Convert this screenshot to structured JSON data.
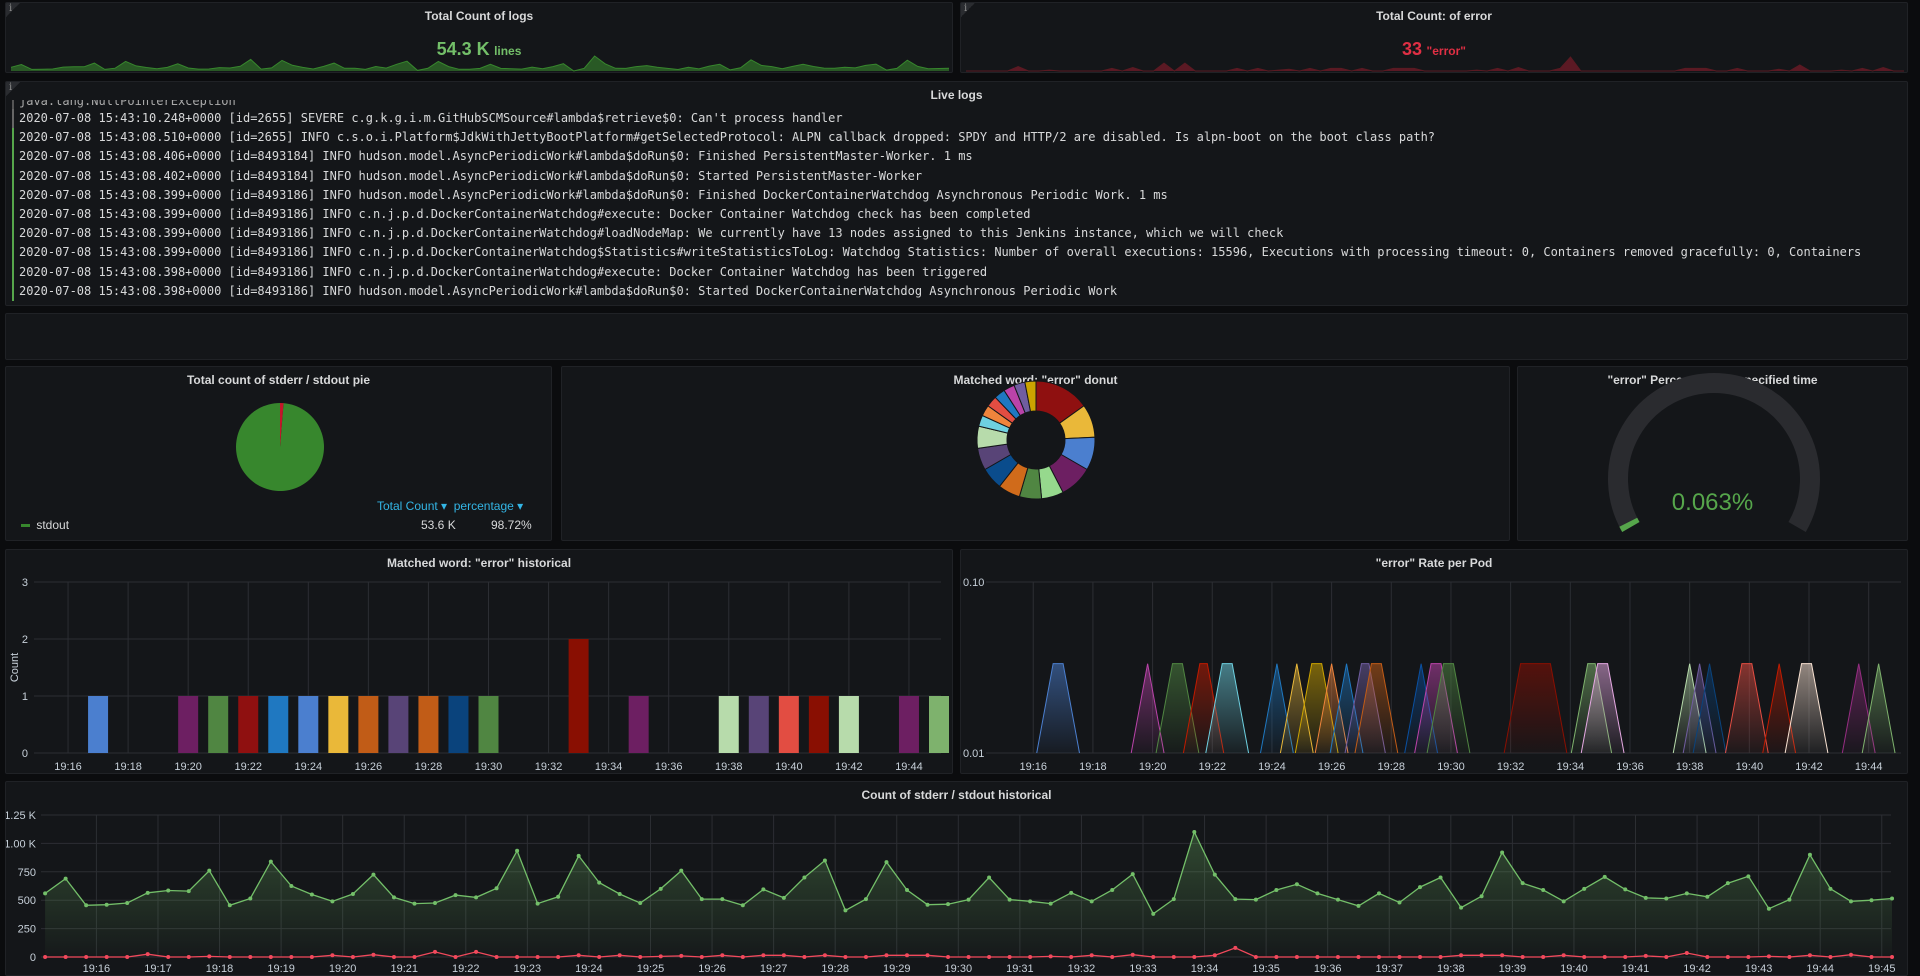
{
  "colors": {
    "green": "#56a64b",
    "green_dark": "#37872d",
    "red": "#e02f44",
    "panel_bg": "#141619",
    "grid": "#2c2e33"
  },
  "panels": {
    "total_logs": {
      "title": "Total Count of logs",
      "value": "54.3 K",
      "unit": "lines",
      "color": "#73bf69"
    },
    "total_errors": {
      "title": "Total Count: of error",
      "value": "33",
      "unit": "\"error\"",
      "color": "#e02f44"
    },
    "live_logs": {
      "title": "Live logs",
      "lines": [
        "java.lang.NullPointerException",
        "2020-07-08 15:43:10.248+0000 [id=2655] SEVERE c.g.k.g.i.m.GitHubSCMSource#lambda$retrieve$0: Can't process handler",
        "2020-07-08 15:43:08.510+0000 [id=2655] INFO c.s.o.i.Platform$JdkWithJettyBootPlatform#getSelectedProtocol: ALPN callback dropped: SPDY and HTTP/2 are disabled. Is alpn-boot on the boot class path?",
        "2020-07-08 15:43:08.406+0000 [id=8493184] INFO hudson.model.AsyncPeriodicWork#lambda$doRun$0: Finished PersistentMaster-Worker. 1 ms",
        "2020-07-08 15:43:08.402+0000 [id=8493184] INFO hudson.model.AsyncPeriodicWork#lambda$doRun$0: Started PersistentMaster-Worker",
        "2020-07-08 15:43:08.399+0000 [id=8493186] INFO hudson.model.AsyncPeriodicWork#lambda$doRun$0: Finished DockerContainerWatchdog Asynchronous Periodic Work. 1 ms",
        "2020-07-08 15:43:08.399+0000 [id=8493186] INFO c.n.j.p.d.DockerContainerWatchdog#execute: Docker Container Watchdog check has been completed",
        "2020-07-08 15:43:08.399+0000 [id=8493186] INFO c.n.j.p.d.DockerContainerWatchdog#loadNodeMap: We currently have 13 nodes assigned to this Jenkins instance, which we will check",
        "2020-07-08 15:43:08.399+0000 [id=8493186] INFO c.n.j.p.d.DockerContainerWatchdog$Statistics#writeStatisticsToLog: Watchdog Statistics: Number of overall executions: 15596, Executions with processing timeout: 0, Containers removed gracefully: 0, Containers",
        "2020-07-08 15:43:08.398+0000 [id=8493186] INFO c.n.j.p.d.DockerContainerWatchdog#execute: Docker Container Watchdog has been triggered",
        "2020-07-08 15:43:08.398+0000 [id=8493186] INFO hudson.model.AsyncPeriodicWork#lambda$doRun$0: Started DockerContainerWatchdog Asynchronous Periodic Work"
      ]
    },
    "pie": {
      "title": "Total count of stderr / stdout pie",
      "col_total": "Total Count",
      "col_pct": "percentage",
      "rows": [
        {
          "name": "stdout",
          "total": "53.6 K",
          "pct": "98.72%",
          "value": 98.72,
          "color": "#37872d"
        }
      ],
      "other_slice": {
        "value": 1.28,
        "color": "#c4162a"
      }
    },
    "donut": {
      "title": "Matched word: \"error\" donut",
      "slices": [
        {
          "value": 5,
          "color": "#8f1010"
        },
        {
          "value": 3,
          "color": "#eab839"
        },
        {
          "value": 3,
          "color": "#4b7fcf"
        },
        {
          "value": 3,
          "color": "#6d1f62"
        },
        {
          "value": 2,
          "color": "#96d98d"
        },
        {
          "value": 2,
          "color": "#508642"
        },
        {
          "value": 2,
          "color": "#d06b1b"
        },
        {
          "value": 2,
          "color": "#0a4c8c"
        },
        {
          "value": 2,
          "color": "#584477"
        },
        {
          "value": 2,
          "color": "#b7dbab"
        },
        {
          "value": 1,
          "color": "#6ed0e0"
        },
        {
          "value": 1,
          "color": "#ef843c"
        },
        {
          "value": 1,
          "color": "#e24d42"
        },
        {
          "value": 1,
          "color": "#1f78c1"
        },
        {
          "value": 1,
          "color": "#ba43a9"
        },
        {
          "value": 1,
          "color": "#705da0"
        },
        {
          "value": 1,
          "color": "#cca300"
        }
      ]
    },
    "gauge": {
      "title": "\"error\" Percentage for specified time",
      "value_text": "0.063%",
      "value": 0.063,
      "min": 0,
      "max": 100,
      "color": "#56a64b"
    }
  },
  "chart_data": [
    {
      "type": "bar",
      "title": "Matched word: \"error\" historical",
      "ylabel": "Count",
      "ylim": [
        0,
        3
      ],
      "yticks": [
        "0",
        "1",
        "2",
        "3"
      ],
      "xticks": [
        "19:16",
        "19:18",
        "19:20",
        "19:22",
        "19:24",
        "19:26",
        "19:28",
        "19:30",
        "19:32",
        "19:34",
        "19:36",
        "19:38",
        "19:40",
        "19:42",
        "19:44"
      ],
      "bars": [
        {
          "x": "19:17",
          "value": 1,
          "color": "#4b7fcf"
        },
        {
          "x": "19:20",
          "value": 1,
          "color": "#6d1f62"
        },
        {
          "x": "19:21",
          "value": 1,
          "color": "#508642"
        },
        {
          "x": "19:22",
          "value": 1,
          "color": "#8f1010"
        },
        {
          "x": "19:23",
          "value": 1,
          "color": "#1f78c1"
        },
        {
          "x": "19:24",
          "value": 1,
          "color": "#4b7fcf"
        },
        {
          "x": "19:25",
          "value": 1,
          "color": "#eab839"
        },
        {
          "x": "19:26",
          "value": 1,
          "color": "#c15c17"
        },
        {
          "x": "19:27",
          "value": 1,
          "color": "#584477"
        },
        {
          "x": "19:28",
          "value": 1,
          "color": "#c15c17"
        },
        {
          "x": "19:29",
          "value": 1,
          "color": "#0a437c"
        },
        {
          "x": "19:30",
          "value": 1,
          "color": "#508642"
        },
        {
          "x": "19:33",
          "value": 2,
          "color": "#890f02"
        },
        {
          "x": "19:35",
          "value": 1,
          "color": "#6d1f62"
        },
        {
          "x": "19:38",
          "value": 1,
          "color": "#b7dbab"
        },
        {
          "x": "19:39",
          "value": 1,
          "color": "#584477"
        },
        {
          "x": "19:40",
          "value": 1,
          "color": "#e24d42"
        },
        {
          "x": "19:41",
          "value": 1,
          "color": "#890f02"
        },
        {
          "x": "19:42",
          "value": 1,
          "color": "#b7dbab"
        },
        {
          "x": "19:44",
          "value": 1,
          "color": "#6d1f62"
        },
        {
          "x": "19:45",
          "value": 1,
          "color": "#7eb26d"
        }
      ]
    },
    {
      "type": "area",
      "title": "\"error\" Rate per Pod",
      "yscale": "log",
      "ylim": [
        0.01,
        0.1
      ],
      "yticks": [
        "0.01",
        "0.10"
      ],
      "xticks": [
        "19:16",
        "19:18",
        "19:20",
        "19:22",
        "19:24",
        "19:26",
        "19:28",
        "19:30",
        "19:32",
        "19:34",
        "19:36",
        "19:38",
        "19:40",
        "19:42",
        "19:44"
      ],
      "peak": 0.0333,
      "spikes": [
        {
          "from": "19:16:40",
          "to": "19:17:00",
          "color": "#4b7fcf"
        },
        {
          "from": "19:19:50",
          "to": "19:19:50",
          "color": "#ba43a9"
        },
        {
          "from": "19:20:40",
          "to": "19:21:00",
          "color": "#508642"
        },
        {
          "from": "19:21:35",
          "to": "19:21:50",
          "color": "#bf1b00"
        },
        {
          "from": "19:22:20",
          "to": "19:22:40",
          "color": "#6ed0e0"
        },
        {
          "from": "19:24:10",
          "to": "19:24:10",
          "color": "#1f78c1"
        },
        {
          "from": "19:24:50",
          "to": "19:24:50",
          "color": "#eab839"
        },
        {
          "from": "19:25:20",
          "to": "19:25:40",
          "color": "#cca300"
        },
        {
          "from": "19:26:00",
          "to": "19:26:00",
          "color": "#ef843c"
        },
        {
          "from": "19:26:30",
          "to": "19:26:30",
          "color": "#1f78c1"
        },
        {
          "from": "19:27:00",
          "to": "19:27:15",
          "color": "#705da0"
        },
        {
          "from": "19:27:20",
          "to": "19:27:40",
          "color": "#c15c17"
        },
        {
          "from": "19:29:00",
          "to": "19:29:00",
          "color": "#0a50a1"
        },
        {
          "from": "19:29:20",
          "to": "19:29:40",
          "color": "#ba43a9"
        },
        {
          "from": "19:29:45",
          "to": "19:30:05",
          "color": "#508642"
        },
        {
          "from": "19:32:20",
          "to": "19:33:20",
          "color": "#890f02"
        },
        {
          "from": "19:34:35",
          "to": "19:34:50",
          "color": "#7eb26d"
        },
        {
          "from": "19:34:55",
          "to": "19:35:15",
          "color": "#e5a8e2"
        },
        {
          "from": "19:38:00",
          "to": "19:38:00",
          "color": "#b7dbab"
        },
        {
          "from": "19:38:20",
          "to": "19:38:20",
          "color": "#705da0"
        },
        {
          "from": "19:38:40",
          "to": "19:38:40",
          "color": "#0a437c"
        },
        {
          "from": "19:39:45",
          "to": "19:40:05",
          "color": "#e24d42"
        },
        {
          "from": "19:41:00",
          "to": "19:41:00",
          "color": "#bf1b00"
        },
        {
          "from": "19:41:45",
          "to": "19:42:05",
          "color": "#f9e2d2"
        },
        {
          "from": "19:43:40",
          "to": "19:43:40",
          "color": "#962d82"
        },
        {
          "from": "19:44:20",
          "to": "19:44:20",
          "color": "#7eb26d"
        }
      ]
    },
    {
      "type": "line",
      "title": "Count of stderr / stdout historical",
      "ylim": [
        0,
        1250
      ],
      "yticks": [
        "0",
        "250",
        "500",
        "750",
        "1.00 K",
        "1.25 K"
      ],
      "xticks": [
        "19:16",
        "19:17",
        "19:18",
        "19:19",
        "19:20",
        "19:21",
        "19:22",
        "19:23",
        "19:24",
        "19:25",
        "19:26",
        "19:27",
        "19:28",
        "19:29",
        "19:30",
        "19:31",
        "19:32",
        "19:33",
        "19:34",
        "19:35",
        "19:36",
        "19:37",
        "19:38",
        "19:39",
        "19:40",
        "19:41",
        "19:42",
        "19:43",
        "19:44",
        "19:45"
      ],
      "x_start": "19:15:10",
      "x_step_seconds": 20,
      "series": [
        {
          "color": "#73bf69",
          "values": [
            560,
            690,
            455,
            460,
            475,
            565,
            585,
            580,
            760,
            455,
            515,
            840,
            625,
            550,
            490,
            555,
            725,
            525,
            470,
            475,
            545,
            525,
            605,
            935,
            470,
            530,
            890,
            655,
            555,
            475,
            600,
            760,
            510,
            510,
            455,
            595,
            520,
            700,
            850,
            410,
            510,
            835,
            590,
            460,
            465,
            505,
            700,
            505,
            490,
            470,
            565,
            490,
            590,
            730,
            380,
            510,
            1100,
            725,
            510,
            505,
            590,
            640,
            560,
            505,
            450,
            560,
            480,
            615,
            700,
            435,
            535,
            920,
            650,
            590,
            490,
            600,
            705,
            595,
            520,
            515,
            560,
            530,
            650,
            710,
            425,
            505,
            900,
            600,
            490,
            500,
            515
          ]
        },
        {
          "color": "#f2495c",
          "values": [
            0,
            0,
            0,
            0,
            0,
            25,
            0,
            0,
            5,
            0,
            0,
            0,
            0,
            0,
            15,
            0,
            20,
            0,
            0,
            45,
            0,
            45,
            0,
            0,
            0,
            0,
            15,
            0,
            15,
            0,
            5,
            10,
            0,
            15,
            0,
            15,
            15,
            0,
            15,
            0,
            0,
            15,
            15,
            15,
            0,
            0,
            0,
            0,
            0,
            5,
            0,
            15,
            0,
            20,
            0,
            0,
            0,
            15,
            80,
            0,
            0,
            0,
            0,
            0,
            0,
            0,
            0,
            0,
            0,
            15,
            15,
            15,
            0,
            0,
            15,
            0,
            0,
            0,
            10,
            0,
            35,
            0,
            0,
            0,
            5,
            0,
            15,
            0,
            20,
            0,
            0
          ]
        }
      ]
    }
  ]
}
